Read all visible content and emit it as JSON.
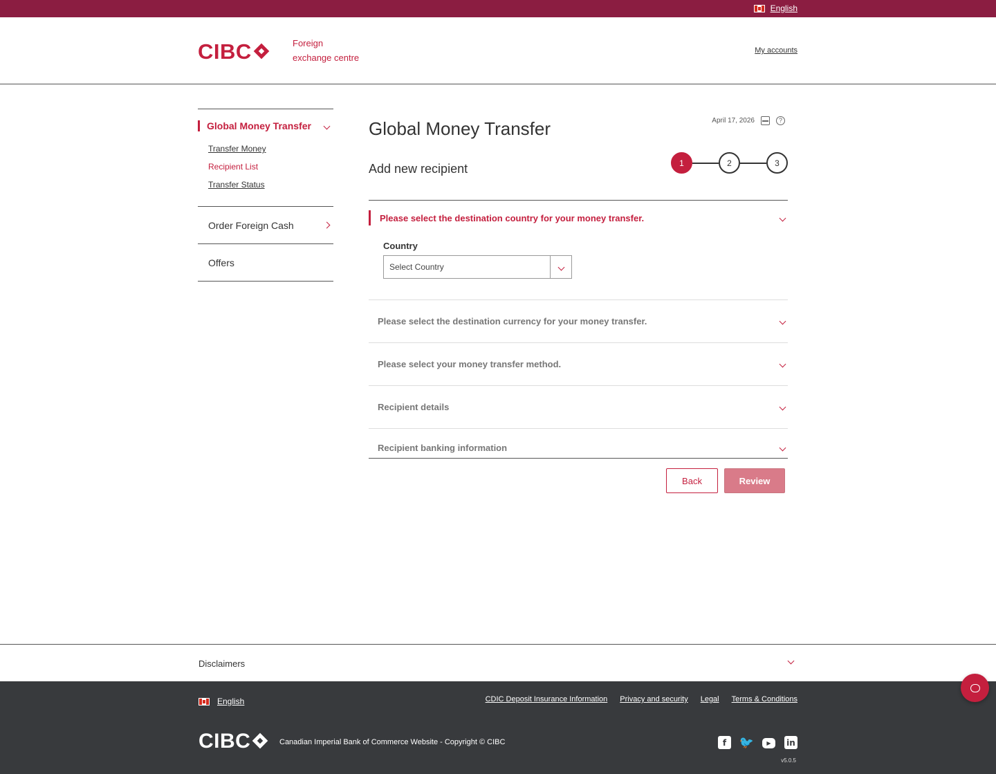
{
  "topbar": {
    "language": "English"
  },
  "header": {
    "logo": "CIBC",
    "subtitle_line1": "Foreign",
    "subtitle_line2": "exchange centre",
    "my_accounts": "My accounts"
  },
  "sidebar": {
    "section1": "Global Money Transfer",
    "sub_items": [
      "Transfer Money",
      "Recipient List",
      "Transfer Status"
    ],
    "section2": "Order Foreign Cash",
    "section3": "Offers"
  },
  "main": {
    "title": "Global Money Transfer",
    "date": "April 17, 2026",
    "subtitle": "Add new recipient",
    "steps": [
      "1",
      "2",
      "3"
    ],
    "accordion": {
      "country_section": "Please select the destination country for your money transfer.",
      "country_label": "Country",
      "country_placeholder": "Select Country",
      "currency_section": "Please select the destination currency for your money transfer.",
      "method_section": "Please select your money transfer method.",
      "recipient_details": "Recipient details",
      "recipient_banking": "Recipient banking information"
    },
    "buttons": {
      "back": "Back",
      "review": "Review"
    }
  },
  "disclaimers": {
    "label": "Disclaimers"
  },
  "footer": {
    "language": "English",
    "links": [
      "CDIC Deposit Insurance Information",
      "Privacy and security",
      "Legal",
      "Terms & Conditions"
    ],
    "logo": "CIBC",
    "copyright": "Canadian Imperial Bank of Commerce Website - Copyright © CIBC",
    "version": "v5.0.5"
  },
  "icons": {
    "facebook": "facebook-icon",
    "twitter": "twitter-icon",
    "youtube": "youtube-icon",
    "linkedin": "linkedin-icon",
    "chat": "chat-icon"
  },
  "colors": {
    "brand": "#c41f3e",
    "topbar": "#8b1d41",
    "footer": "#383a3d"
  }
}
